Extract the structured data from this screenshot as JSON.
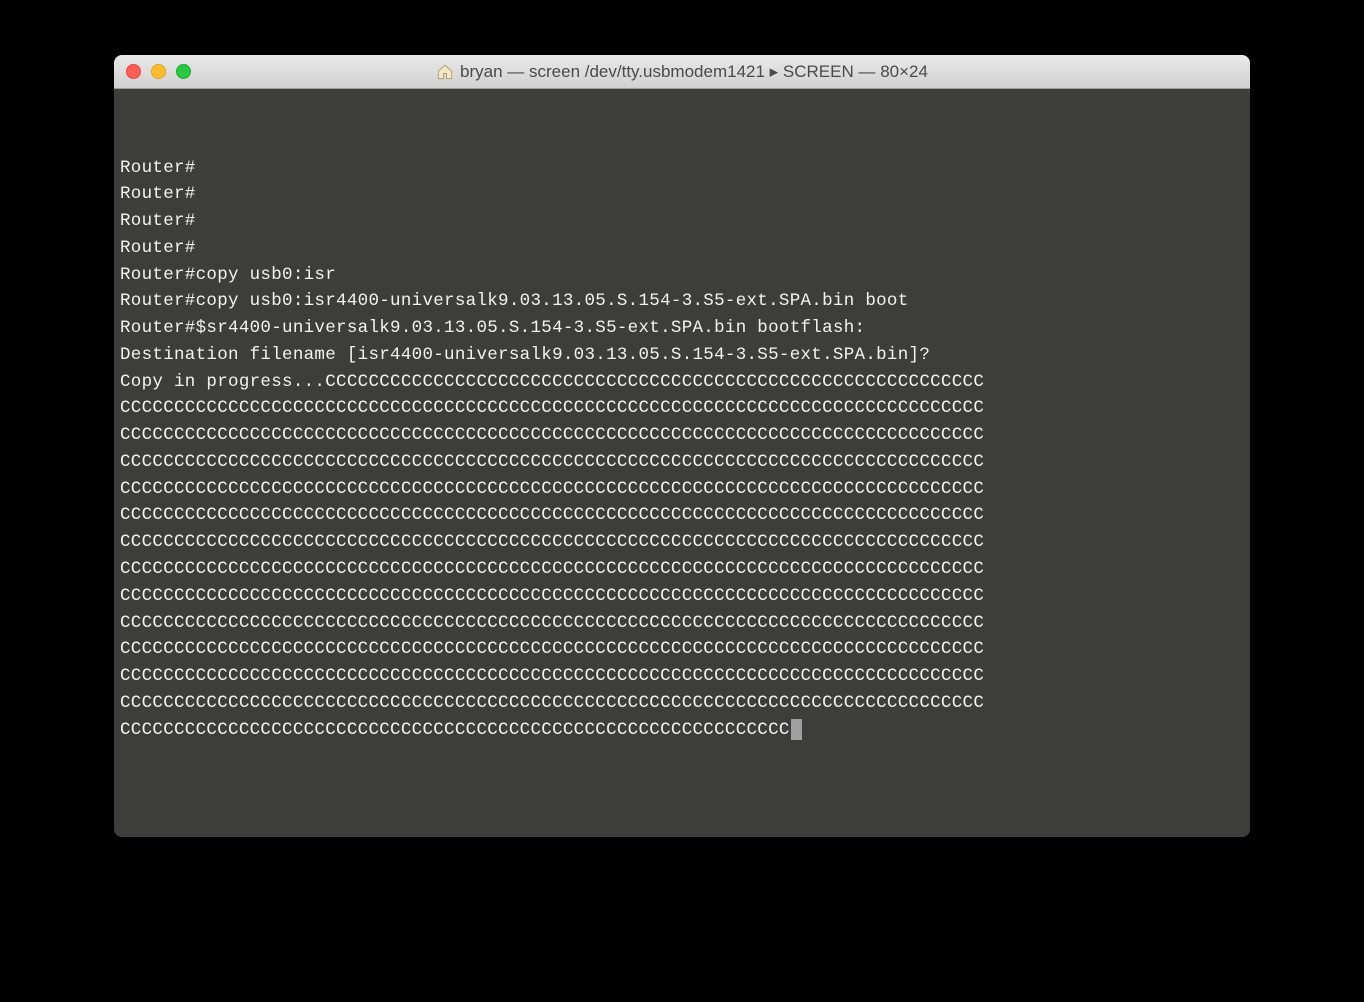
{
  "window": {
    "title": "bryan — screen /dev/tty.usbmodem1421 ▸ SCREEN — 80×24"
  },
  "terminal": {
    "lines": [
      "Router#",
      "Router#",
      "Router#",
      "Router#",
      "Router#copy usb0:isr",
      "Router#copy usb0:isr4400-universalk9.03.13.05.S.154-3.S5-ext.SPA.bin boot",
      "Router#$sr4400-universalk9.03.13.05.S.154-3.S5-ext.SPA.bin bootflash:",
      "Destination filename [isr4400-universalk9.03.13.05.S.154-3.S5-ext.SPA.bin]?",
      "Copy in progress...CCCCCCCCCCCCCCCCCCCCCCCCCCCCCCCCCCCCCCCCCCCCCCCCCCCCCCCCCCCCC",
      "CCCCCCCCCCCCCCCCCCCCCCCCCCCCCCCCCCCCCCCCCCCCCCCCCCCCCCCCCCCCCCCCCCCCCCCCCCCCCCCC",
      "CCCCCCCCCCCCCCCCCCCCCCCCCCCCCCCCCCCCCCCCCCCCCCCCCCCCCCCCCCCCCCCCCCCCCCCCCCCCCCCC",
      "CCCCCCCCCCCCCCCCCCCCCCCCCCCCCCCCCCCCCCCCCCCCCCCCCCCCCCCCCCCCCCCCCCCCCCCCCCCCCCCC",
      "CCCCCCCCCCCCCCCCCCCCCCCCCCCCCCCCCCCCCCCCCCCCCCCCCCCCCCCCCCCCCCCCCCCCCCCCCCCCCCCC",
      "CCCCCCCCCCCCCCCCCCCCCCCCCCCCCCCCCCCCCCCCCCCCCCCCCCCCCCCCCCCCCCCCCCCCCCCCCCCCCCCC",
      "CCCCCCCCCCCCCCCCCCCCCCCCCCCCCCCCCCCCCCCCCCCCCCCCCCCCCCCCCCCCCCCCCCCCCCCCCCCCCCCC",
      "CCCCCCCCCCCCCCCCCCCCCCCCCCCCCCCCCCCCCCCCCCCCCCCCCCCCCCCCCCCCCCCCCCCCCCCCCCCCCCCC",
      "CCCCCCCCCCCCCCCCCCCCCCCCCCCCCCCCCCCCCCCCCCCCCCCCCCCCCCCCCCCCCCCCCCCCCCCCCCCCCCCC",
      "CCCCCCCCCCCCCCCCCCCCCCCCCCCCCCCCCCCCCCCCCCCCCCCCCCCCCCCCCCCCCCCCCCCCCCCCCCCCCCCC",
      "CCCCCCCCCCCCCCCCCCCCCCCCCCCCCCCCCCCCCCCCCCCCCCCCCCCCCCCCCCCCCCCCCCCCCCCCCCCCCCCC",
      "CCCCCCCCCCCCCCCCCCCCCCCCCCCCCCCCCCCCCCCCCCCCCCCCCCCCCCCCCCCCCCCCCCCCCCCCCCCCCCCC",
      "CCCCCCCCCCCCCCCCCCCCCCCCCCCCCCCCCCCCCCCCCCCCCCCCCCCCCCCCCCCCCCCCCCCCCCCCCCCCCCCC",
      "CCCCCCCCCCCCCCCCCCCCCCCCCCCCCCCCCCCCCCCCCCCCCCCCCCCCCCCCCCCCCC"
    ]
  }
}
